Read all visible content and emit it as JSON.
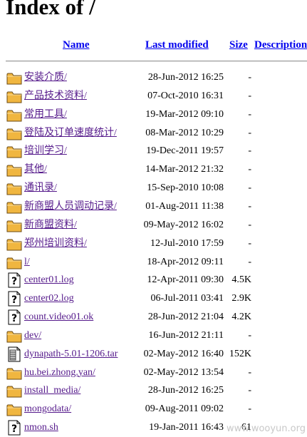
{
  "page": {
    "title": "Index of /"
  },
  "columns": {
    "name": "Name",
    "last_modified": "Last modified",
    "size": "Size",
    "description": "Description"
  },
  "entries": [
    {
      "name": "安装介质/",
      "modified": "28-Jun-2012 16:25",
      "size": "-",
      "icon": "folder-icon"
    },
    {
      "name": "产品技术资料/",
      "modified": "07-Oct-2010 16:31",
      "size": "-",
      "icon": "folder-icon"
    },
    {
      "name": "常用工具/",
      "modified": "19-Mar-2012 09:10",
      "size": "-",
      "icon": "folder-icon"
    },
    {
      "name": "登陆及订单速度统计/",
      "modified": "08-Mar-2012 10:29",
      "size": "-",
      "icon": "folder-icon"
    },
    {
      "name": "培训学习/",
      "modified": "19-Dec-2011 19:57",
      "size": "-",
      "icon": "folder-icon"
    },
    {
      "name": "其他/",
      "modified": "14-Mar-2012 21:32",
      "size": "-",
      "icon": "folder-icon"
    },
    {
      "name": "通讯录/",
      "modified": "15-Sep-2010 10:08",
      "size": "-",
      "icon": "folder-icon"
    },
    {
      "name": "新商盟人员调动记录/",
      "modified": "01-Aug-2011 11:38",
      "size": "-",
      "icon": "folder-icon"
    },
    {
      "name": "新商盟资料/",
      "modified": "09-May-2012 16:02",
      "size": "-",
      "icon": "folder-icon"
    },
    {
      "name": "郑州培训资料/",
      "modified": "12-Jul-2010 17:59",
      "size": "-",
      "icon": "folder-icon"
    },
    {
      "name": "l/",
      "modified": "18-Apr-2012 09:11",
      "size": "-",
      "icon": "folder-icon"
    },
    {
      "name": "center01.log",
      "modified": "12-Apr-2011 09:30",
      "size": "4.5K",
      "icon": "unknown-file-icon"
    },
    {
      "name": "center02.log",
      "modified": "06-Jul-2011 03:41",
      "size": "2.9K",
      "icon": "unknown-file-icon"
    },
    {
      "name": "count.video01.ok",
      "modified": "28-Jun-2012 21:04",
      "size": "4.2K",
      "icon": "unknown-file-icon"
    },
    {
      "name": "dev/",
      "modified": "16-Jun-2012 21:11",
      "size": "-",
      "icon": "folder-icon"
    },
    {
      "name": "dynapath-5.01-1206.tar",
      "modified": "02-May-2012 16:40",
      "size": "152K",
      "icon": "archive-file-icon"
    },
    {
      "name": "hu.bei.zhong.yan/",
      "modified": "02-May-2012 13:54",
      "size": "-",
      "icon": "folder-icon"
    },
    {
      "name": "install_media/",
      "modified": "28-Jun-2012 16:25",
      "size": "-",
      "icon": "folder-icon"
    },
    {
      "name": "mongodata/",
      "modified": "09-Aug-2011 09:02",
      "size": "-",
      "icon": "folder-icon"
    },
    {
      "name": "nmon.sh",
      "modified": "19-Jan-2011 16:43",
      "size": "61",
      "icon": "unknown-file-icon"
    }
  ],
  "watermark": "www.wooyun.org"
}
